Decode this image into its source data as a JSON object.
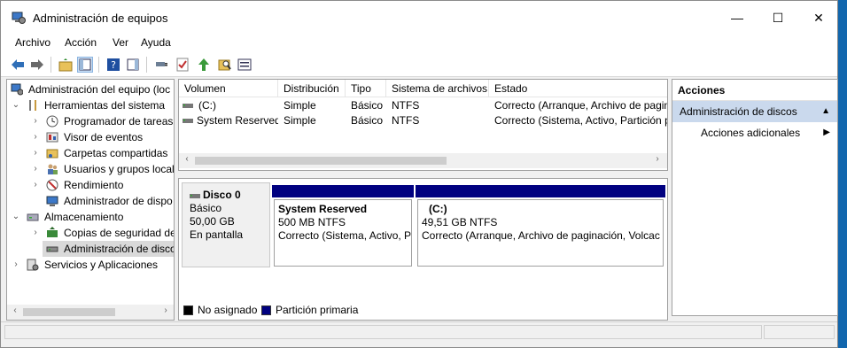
{
  "window": {
    "title": "Administración de equipos",
    "minimize": "—",
    "maximize": "☐",
    "close": "✕"
  },
  "menu": [
    "Archivo",
    "Acción",
    "Ver",
    "Ayuda"
  ],
  "tree": {
    "items": [
      {
        "label": "Administración del equipo (loc",
        "icon": "computer-management-icon"
      },
      {
        "label": "Herramientas del sistema",
        "icon": "tools-icon"
      },
      {
        "label": "Programador de tareas",
        "icon": "clock-icon"
      },
      {
        "label": "Visor de eventos",
        "icon": "event-viewer-icon"
      },
      {
        "label": "Carpetas compartidas",
        "icon": "shared-folder-icon"
      },
      {
        "label": "Usuarios y grupos locale",
        "icon": "users-icon"
      },
      {
        "label": "Rendimiento",
        "icon": "performance-icon"
      },
      {
        "label": "Administrador de dispo",
        "icon": "device-manager-icon"
      },
      {
        "label": "Almacenamiento",
        "icon": "storage-icon"
      },
      {
        "label": "Copias de seguridad de",
        "icon": "backup-icon"
      },
      {
        "label": "Administración de disco",
        "icon": "disk-icon"
      },
      {
        "label": "Servicios y Aplicaciones",
        "icon": "services-icon"
      }
    ]
  },
  "volumes": {
    "columns": [
      "Volumen",
      "Distribución",
      "Tipo",
      "Sistema de archivos",
      "Estado"
    ],
    "rows": [
      {
        "volume": "(C:)",
        "layout": "Simple",
        "type": "Básico",
        "fs": "NTFS",
        "status": "Correcto (Arranque, Archivo de pagin"
      },
      {
        "volume": "System Reserved",
        "layout": "Simple",
        "type": "Básico",
        "fs": "NTFS",
        "status": "Correcto (Sistema, Activo, Partición p"
      }
    ]
  },
  "disk": {
    "name": "Disco 0",
    "kind": "Básico",
    "size": "50,00 GB",
    "state": "En pantalla",
    "partitions": [
      {
        "name": "System Reserved",
        "size": "500 MB NTFS",
        "status": "Correcto (Sistema, Activo, P"
      },
      {
        "name": "(C:)",
        "size": "49,51 GB NTFS",
        "status": "Correcto (Arranque, Archivo de paginación, Volcac"
      }
    ]
  },
  "legend": {
    "unallocated": "No asignado",
    "primary": "Partición primaria",
    "unallocated_color": "#000000",
    "primary_color": "#000080"
  },
  "actions": {
    "header": "Acciones",
    "section": "Administración de discos",
    "more": "Acciones adicionales"
  }
}
